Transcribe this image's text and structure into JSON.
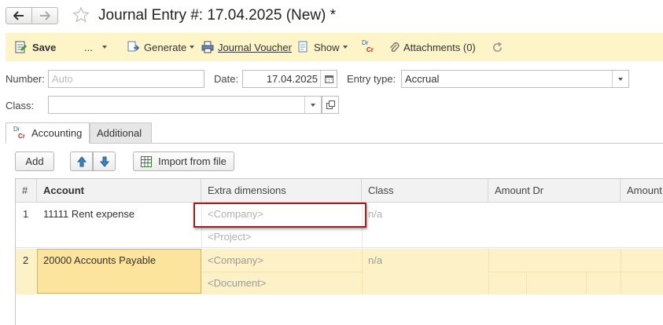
{
  "window": {
    "title": "Journal Entry #:  17.04.2025 (New) *"
  },
  "toolbar": {
    "save": "Save",
    "more": "...",
    "generate": "Generate",
    "journal_voucher": "Journal Voucher",
    "show": "Show",
    "drcr_dr": "Dr",
    "drcr_cr": "Cr",
    "attachments": "Attachments (0)"
  },
  "form": {
    "number_label": "Number:",
    "number_placeholder": "Auto",
    "date_label": "Date:",
    "date_value": "17.04.2025",
    "entry_type_label": "Entry type:",
    "entry_type_value": "Accrual",
    "class_label": "Class:",
    "class_value": ""
  },
  "tabs": [
    {
      "label": "Accounting",
      "icon_dr": "Dr",
      "icon_cr": "Cr",
      "active": true
    },
    {
      "label": "Additional",
      "active": false
    }
  ],
  "table_toolbar": {
    "add": "Add",
    "import": "Import from file"
  },
  "table": {
    "columns": [
      "#",
      "Account",
      "Extra dimensions",
      "Class",
      "Amount Dr",
      "Amount"
    ],
    "rows": [
      {
        "num": "1",
        "account": "11111 Rent expense",
        "dims": [
          "<Company>",
          "<Project>"
        ],
        "class": "n/a"
      },
      {
        "num": "2",
        "account": "20000 Accounts Payable",
        "dims": [
          "<Company>",
          "<Document>"
        ],
        "class": "n/a"
      }
    ]
  },
  "colors": {
    "toolbar_bg": "#fdf4c8",
    "selected_row_bg": "#fdf1c8",
    "selected_cell_bg": "#fde49c",
    "highlight_box": "#a31d1d"
  }
}
